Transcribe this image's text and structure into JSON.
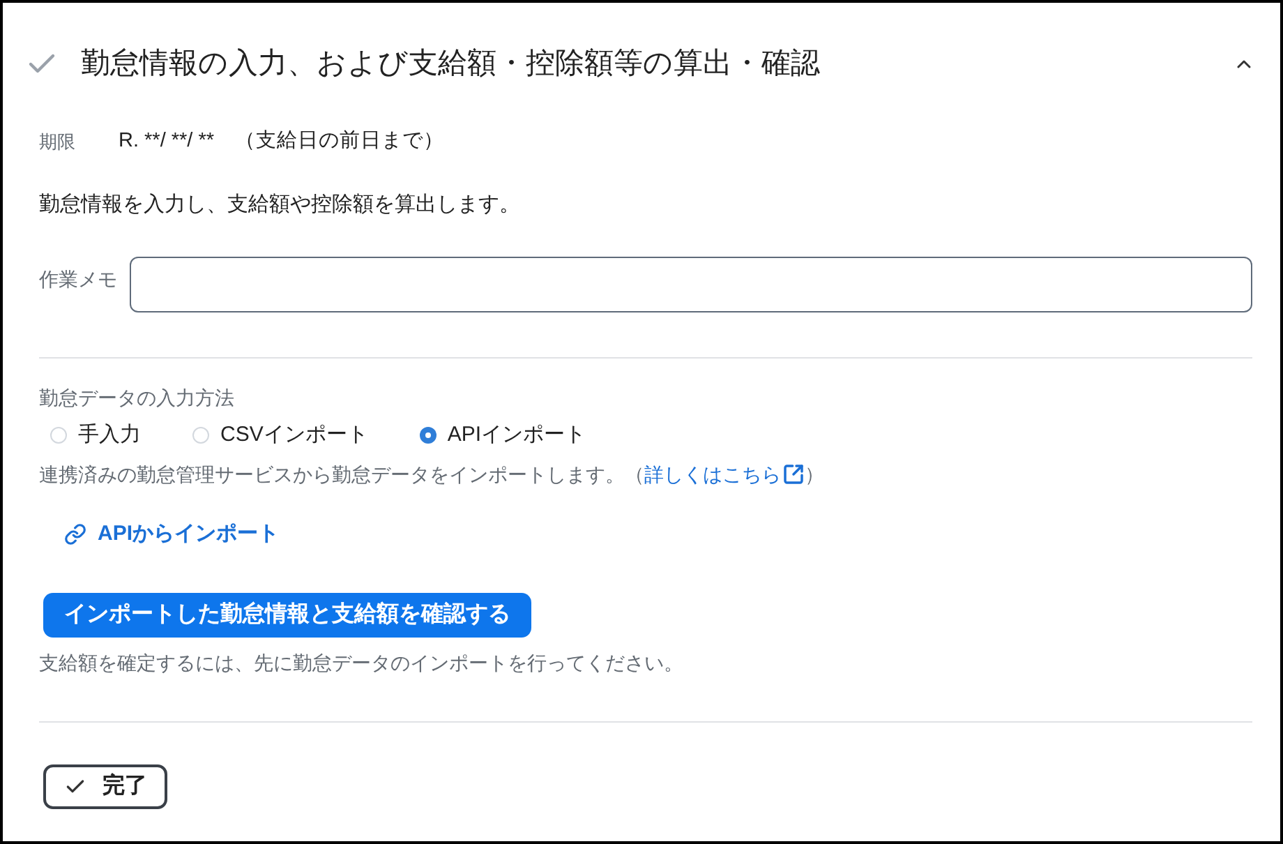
{
  "section": {
    "title": "勤怠情報の入力、および支給額・控除額等の算出・確認",
    "expanded": true
  },
  "deadline": {
    "label": "期限",
    "value": "R. **/ **/ **　（支給日の前日まで）"
  },
  "description": "勤怠情報を入力し、支給額や控除額を算出します。",
  "memo": {
    "label": "作業メモ"
  },
  "input_method": {
    "label": "勤怠データの入力方法",
    "options": [
      {
        "label": "手入力",
        "selected": false
      },
      {
        "label": "CSVインポート",
        "selected": false
      },
      {
        "label": "APIインポート",
        "selected": true
      }
    ],
    "help": {
      "text": "連携済みの勤怠管理サービスから勤怠データをインポートします。（",
      "link": "詳しくはこちら",
      "suffix": "）"
    }
  },
  "import_link": {
    "label": "APIからインポート"
  },
  "confirm_button": {
    "label": "インポートした勤怠情報と支給額を確認する"
  },
  "note": "支給額を確定するには、先に勤怠データのインポートを行ってください。",
  "done_button": {
    "label": "完了"
  }
}
